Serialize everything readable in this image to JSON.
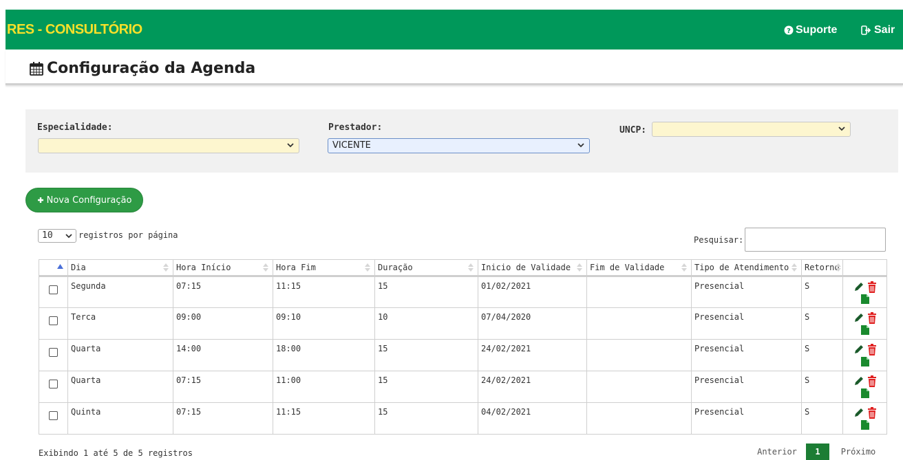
{
  "navbar": {
    "brand": "RES - CONSULTÓRIO",
    "support_label": "Suporte",
    "logout_label": "Sair",
    "brand_color": "#f6e02a",
    "bg_color": "#00985a"
  },
  "page": {
    "title": "Configuração da Agenda",
    "title_icon": "calendar-icon"
  },
  "filters": {
    "especialidade_label": "Especialidade:",
    "especialidade_value": "",
    "prestador_label": "Prestador:",
    "prestador_value": "VICENTE",
    "uncp_label": "UNCP:",
    "uncp_value": ""
  },
  "toolbar": {
    "new_button_label": "Nova Configuração"
  },
  "table_controls": {
    "page_length": "10",
    "page_length_label": "registros por página",
    "search_label": "Pesquisar:",
    "search_value": ""
  },
  "table": {
    "columns": [
      "Dia",
      "Hora Início",
      "Hora Fim",
      "Duração",
      "Inicio de Validade",
      "Fim de Validade",
      "Tipo de Atendimento",
      "Retorno"
    ],
    "rows": [
      {
        "dia": "Segunda",
        "hora_inicio": "07:15",
        "hora_fim": "11:15",
        "duracao": "15",
        "inicio_validade": "01/02/2021",
        "fim_validade": "",
        "tipo": "Presencial",
        "retorno": "S"
      },
      {
        "dia": "Terca",
        "hora_inicio": "09:00",
        "hora_fim": "09:10",
        "duracao": "10",
        "inicio_validade": "07/04/2020",
        "fim_validade": "",
        "tipo": "Presencial",
        "retorno": "S"
      },
      {
        "dia": "Quarta",
        "hora_inicio": "14:00",
        "hora_fim": "18:00",
        "duracao": "15",
        "inicio_validade": "24/02/2021",
        "fim_validade": "",
        "tipo": "Presencial",
        "retorno": "S"
      },
      {
        "dia": "Quarta",
        "hora_inicio": "07:15",
        "hora_fim": "11:00",
        "duracao": "15",
        "inicio_validade": "24/02/2021",
        "fim_validade": "",
        "tipo": "Presencial",
        "retorno": "S"
      },
      {
        "dia": "Quinta",
        "hora_inicio": "07:15",
        "hora_fim": "11:15",
        "duracao": "15",
        "inicio_validade": "04/02/2021",
        "fim_validade": "",
        "tipo": "Presencial",
        "retorno": "S"
      }
    ]
  },
  "footer": {
    "info": "Exibindo 1 até 5 de 5 registros",
    "prev_label": "Anterior",
    "current_page": "1",
    "next_label": "Próximo"
  }
}
